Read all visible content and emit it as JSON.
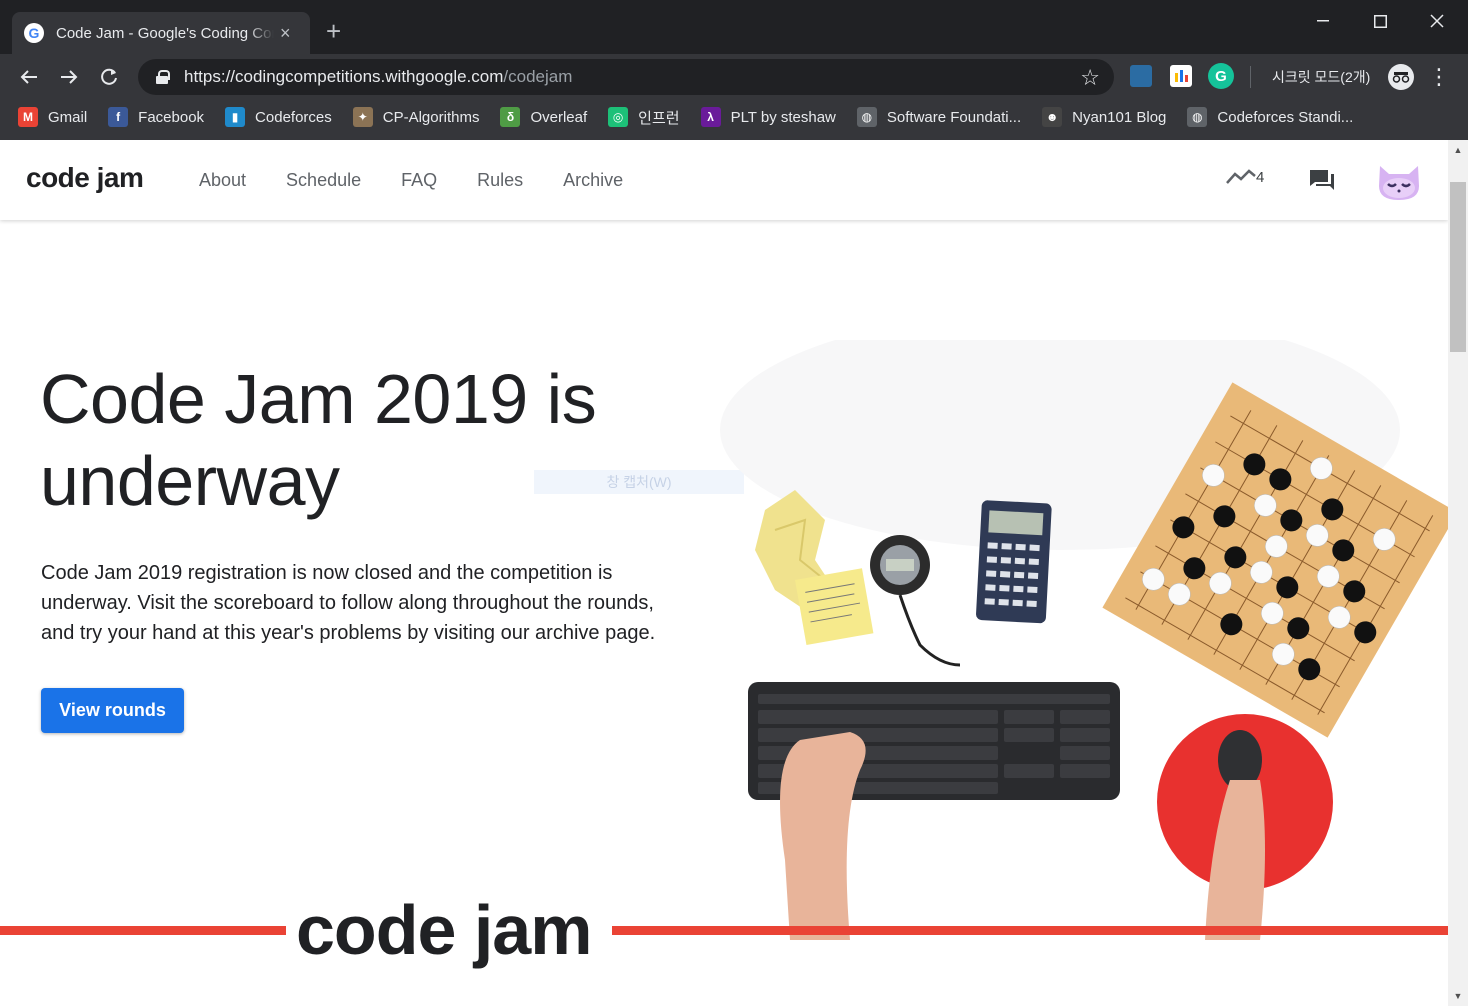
{
  "browser": {
    "tab_title": "Code Jam - Google's Coding Competitions",
    "tab_close": "×",
    "new_tab": "+",
    "url_host": "https://codingcompetitions.withgoogle.com",
    "url_path": "/codejam",
    "incognito_label": "시크릿 모드(2개)",
    "window_controls": [
      "minimize",
      "maximize",
      "close"
    ]
  },
  "bookmarks": [
    {
      "label": "Gmail",
      "icon": "gmail-icon",
      "color": "#ea4335",
      "glyph": "M"
    },
    {
      "label": "Facebook",
      "icon": "facebook-icon",
      "color": "#3b5998",
      "glyph": "f"
    },
    {
      "label": "Codeforces",
      "icon": "codeforces-icon",
      "color": "#1f8acb",
      "glyph": "▮"
    },
    {
      "label": "CP-Algorithms",
      "icon": "cp-algorithms-icon",
      "color": "#8b7355",
      "glyph": "✦"
    },
    {
      "label": "Overleaf",
      "icon": "overleaf-icon",
      "color": "#4f9c45",
      "glyph": "δ"
    },
    {
      "label": "인프런",
      "icon": "inflearn-icon",
      "color": "#1dc078",
      "glyph": "◎"
    },
    {
      "label": "PLT by steshaw",
      "icon": "plt-icon",
      "color": "#6a1b9a",
      "glyph": "λ"
    },
    {
      "label": "Software Foundati...",
      "icon": "globe-icon",
      "color": "#5f6368",
      "glyph": "◍"
    },
    {
      "label": "Nyan101 Blog",
      "icon": "nyan-icon",
      "color": "#444444",
      "glyph": "☻"
    },
    {
      "label": "Codeforces Standi...",
      "icon": "globe-icon",
      "color": "#5f6368",
      "glyph": "◍"
    }
  ],
  "site": {
    "logo": "code jam",
    "nav": [
      "About",
      "Schedule",
      "FAQ",
      "Rules",
      "Archive"
    ],
    "trend_count": "4"
  },
  "hero": {
    "title": "Code Jam 2019 is underway",
    "body": "Code Jam 2019 registration is now closed and the competition is underway. Visit the scoreboard to follow along throughout the rounds, and try your hand at this year's problems by visiting our archive page.",
    "button": "View rounds"
  },
  "overlay_hint": "창 캡처(W)",
  "footer_logo": "code jam",
  "colors": {
    "accent_blue": "#1a73e8",
    "brand_red": "#ea4335"
  }
}
